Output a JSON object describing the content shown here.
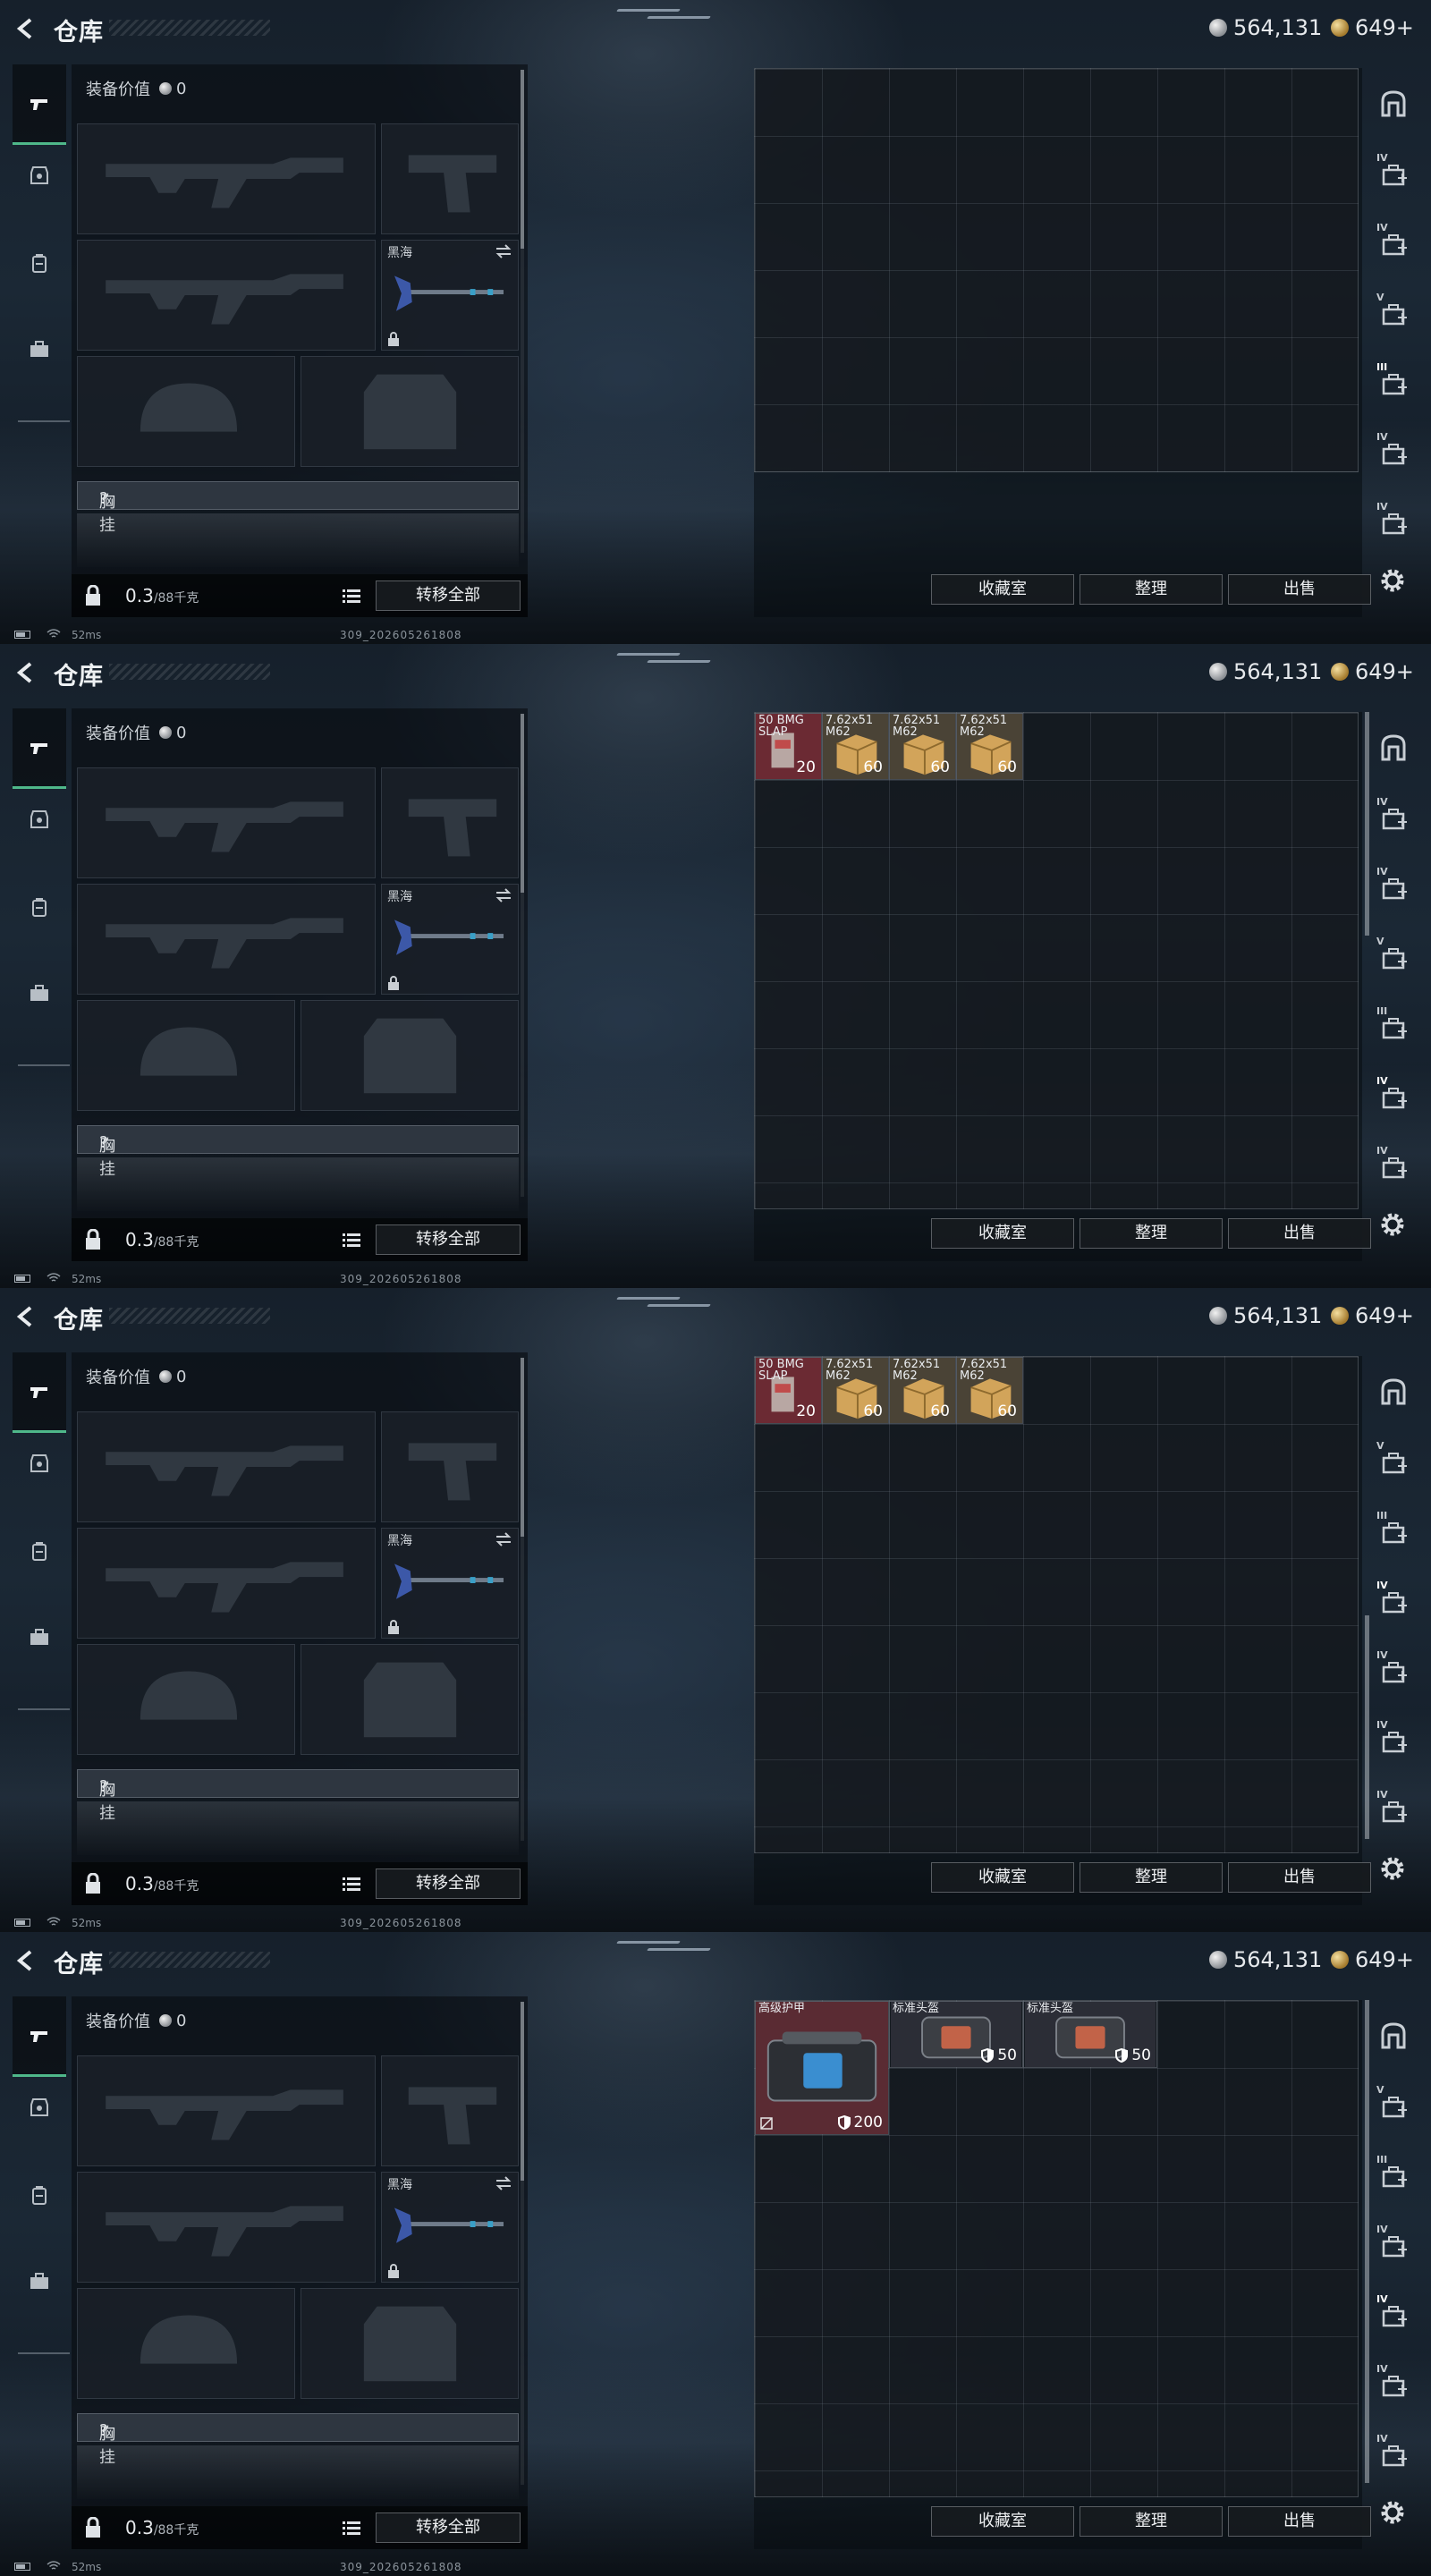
{
  "app": {
    "title": "仓库",
    "currency_silver": "564,131",
    "currency_gold": "649+"
  },
  "equipment": {
    "value_label": "装备价值",
    "value": "0",
    "melee_name": "黑海",
    "rig_label": "胸挂",
    "rig_help": "?",
    "weight_current": "0.3",
    "weight_max": "/88千克",
    "transfer_all": "转移全部"
  },
  "storage": {
    "buttons": {
      "collection": "收藏室",
      "sort": "整理",
      "sell": "出售"
    }
  },
  "status": {
    "ping": "52ms",
    "build": "309_202605261808"
  },
  "items": {
    "bmg": {
      "name": "50 BMG\nSLAP",
      "count": "20"
    },
    "m62a": {
      "name": "7.62x51\nM62",
      "count": "60"
    },
    "m62b": {
      "name": "7.62x51\nM62",
      "count": "60"
    },
    "m62c": {
      "name": "7.62x51\nM62",
      "count": "60"
    },
    "armor": {
      "name": "高级护甲",
      "durability": "200"
    },
    "helmet1": {
      "name": "标准头盔",
      "durability": "50"
    },
    "helmet2": {
      "name": "标准头盔",
      "durability": "50"
    }
  },
  "right_tabs": {
    "tier_iii": "III",
    "tier_iv": "IV",
    "tier_v": "V"
  },
  "colors": {
    "accent_green": "#4fb88a",
    "red_item_bg": "#6b2a33",
    "ammo_bg": "#4f4630"
  }
}
